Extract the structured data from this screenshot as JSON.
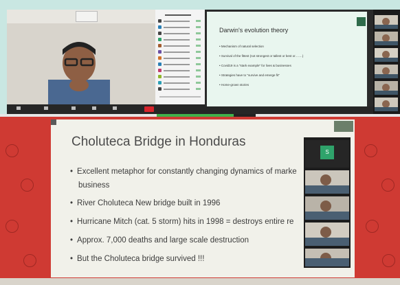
{
  "top_right_slide": {
    "title": "Darwin's evolution theory",
    "bullets": [
      "• Mechanism of natural selection",
      "• Survival of the fittest (not strongest or tallest or best or…….)",
      "• Covid19 is a \"stark example\" for lives & businesses",
      "• Strategies have to \"survive and emerge fit\"",
      "• Home-grown stories"
    ]
  },
  "main_slide": {
    "title": "Choluteca Bridge in Honduras",
    "bullets": [
      "Excellent metaphor for constantly changing dynamics of marke",
      "business",
      "River Choluteca New bridge built in 1996",
      "Hurricane Mitch (cat. 5 storm) hits in 1998 = destroys entire re",
      "Approx. 7,000 deaths and large scale destruction",
      "But the Choluteca bridge survived !!!"
    ]
  },
  "participant_avatar": "S",
  "colors": {
    "end_button": "#d8242b",
    "zoom_bg": "#1e1e1e",
    "slide_bg": "#f1f1ea",
    "accent_red": "#cf3a33",
    "green": "#41b14b"
  }
}
